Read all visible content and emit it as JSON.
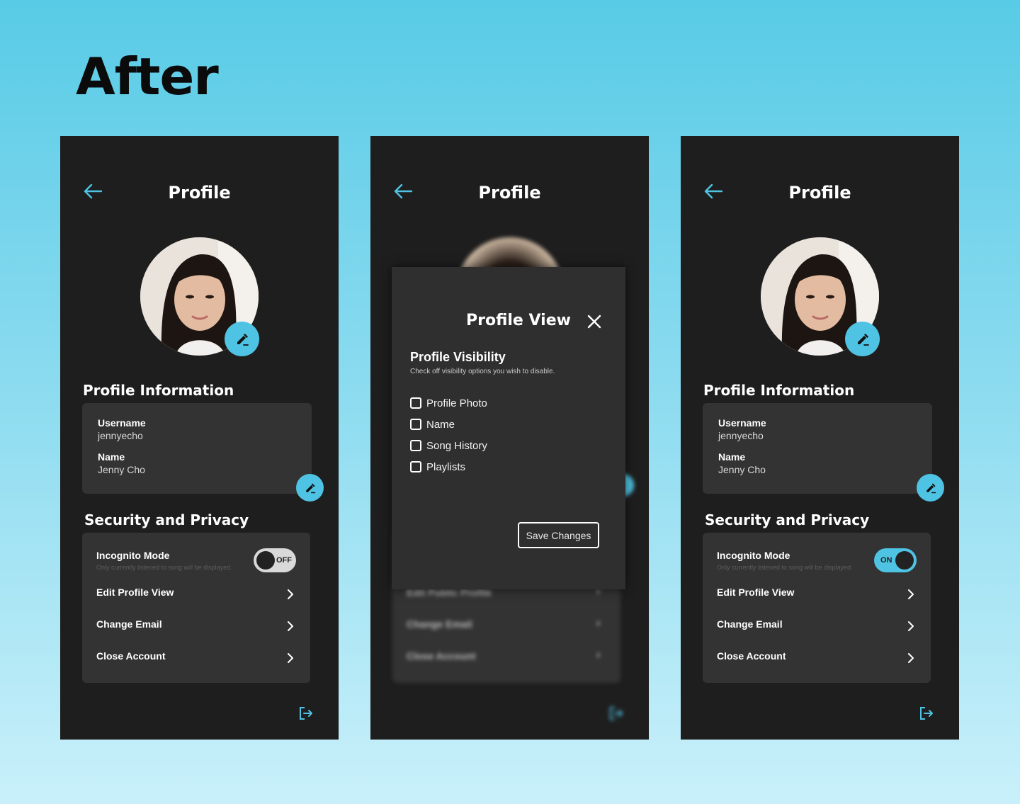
{
  "headline": "After",
  "colors": {
    "accent": "#4fc3e3",
    "screen_bg": "#1e1e1e",
    "card_bg": "#333333"
  },
  "profile": {
    "title": "Profile",
    "profile_info_heading": "Profile Information",
    "username_label": "Username",
    "username_value": "jennyecho",
    "name_label": "Name",
    "name_value": "Jenny Cho",
    "security_heading": "Security and Privacy",
    "incognito_label": "Incognito Mode",
    "incognito_sub": "Only currently listened to song will be displayed.",
    "toggle_off": "OFF",
    "toggle_on": "ON",
    "menu": [
      "Edit Profile View",
      "Change Email",
      "Close Account"
    ],
    "icons": [
      "back-arrow-icon",
      "pencil-icon",
      "chevron-right-icon",
      "logout-icon"
    ]
  },
  "modal": {
    "title": "Profile View",
    "visibility_heading": "Profile Visibility",
    "visibility_sub": "Check off visibility options you wish to disable.",
    "options": [
      "Profile Photo",
      "Name",
      "Song History",
      "Playlists"
    ],
    "save_label": "Save Changes",
    "background_rows": [
      "Edit Public Profile",
      "Change Email",
      "Close Account"
    ]
  }
}
